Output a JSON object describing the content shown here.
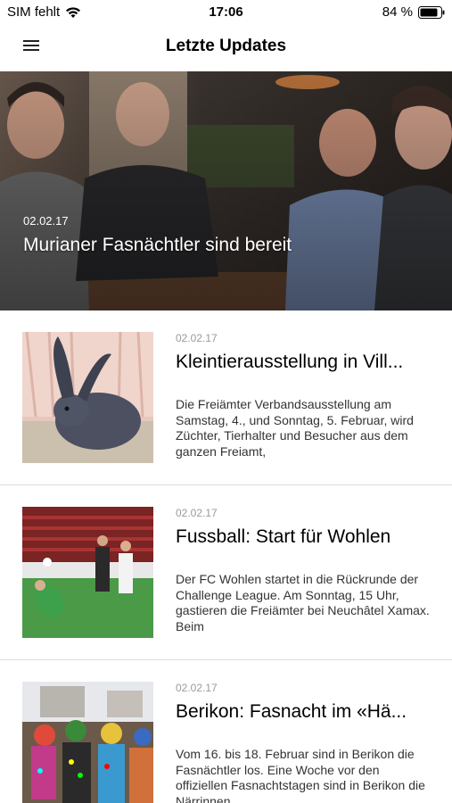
{
  "status_bar": {
    "carrier": "SIM fehlt",
    "time": "17:06",
    "battery": "84 %"
  },
  "nav": {
    "title": "Letzte Updates"
  },
  "hero": {
    "date": "02.02.17",
    "title": "Murianer Fasnächtler sind bereit"
  },
  "articles": [
    {
      "date": "02.02.17",
      "title": "Kleintierausstellung in Vill...",
      "excerpt": "Die Freiämter Verbandsausstellung am Samstag, 4., und Sonntag, 5. Februar, wird Züchter, Tierhalter und Besucher aus dem ganzen Freiamt,"
    },
    {
      "date": "02.02.17",
      "title": "Fussball: Start für Wohlen",
      "excerpt": "Der FC Wohlen startet in die Rückrunde der Challenge League. Am Sonntag, 15 Uhr, gastieren die Freiämter bei Neuchâtel Xamax. Beim"
    },
    {
      "date": "02.02.17",
      "title": "Berikon: Fasnacht im «Hä...",
      "excerpt": "Vom 16. bis 18. Februar sind in Berikon die Fasnächtler los. Eine Woche vor den offiziellen Fasnachtstagen sind in Berikon die Närrinnen"
    }
  ]
}
